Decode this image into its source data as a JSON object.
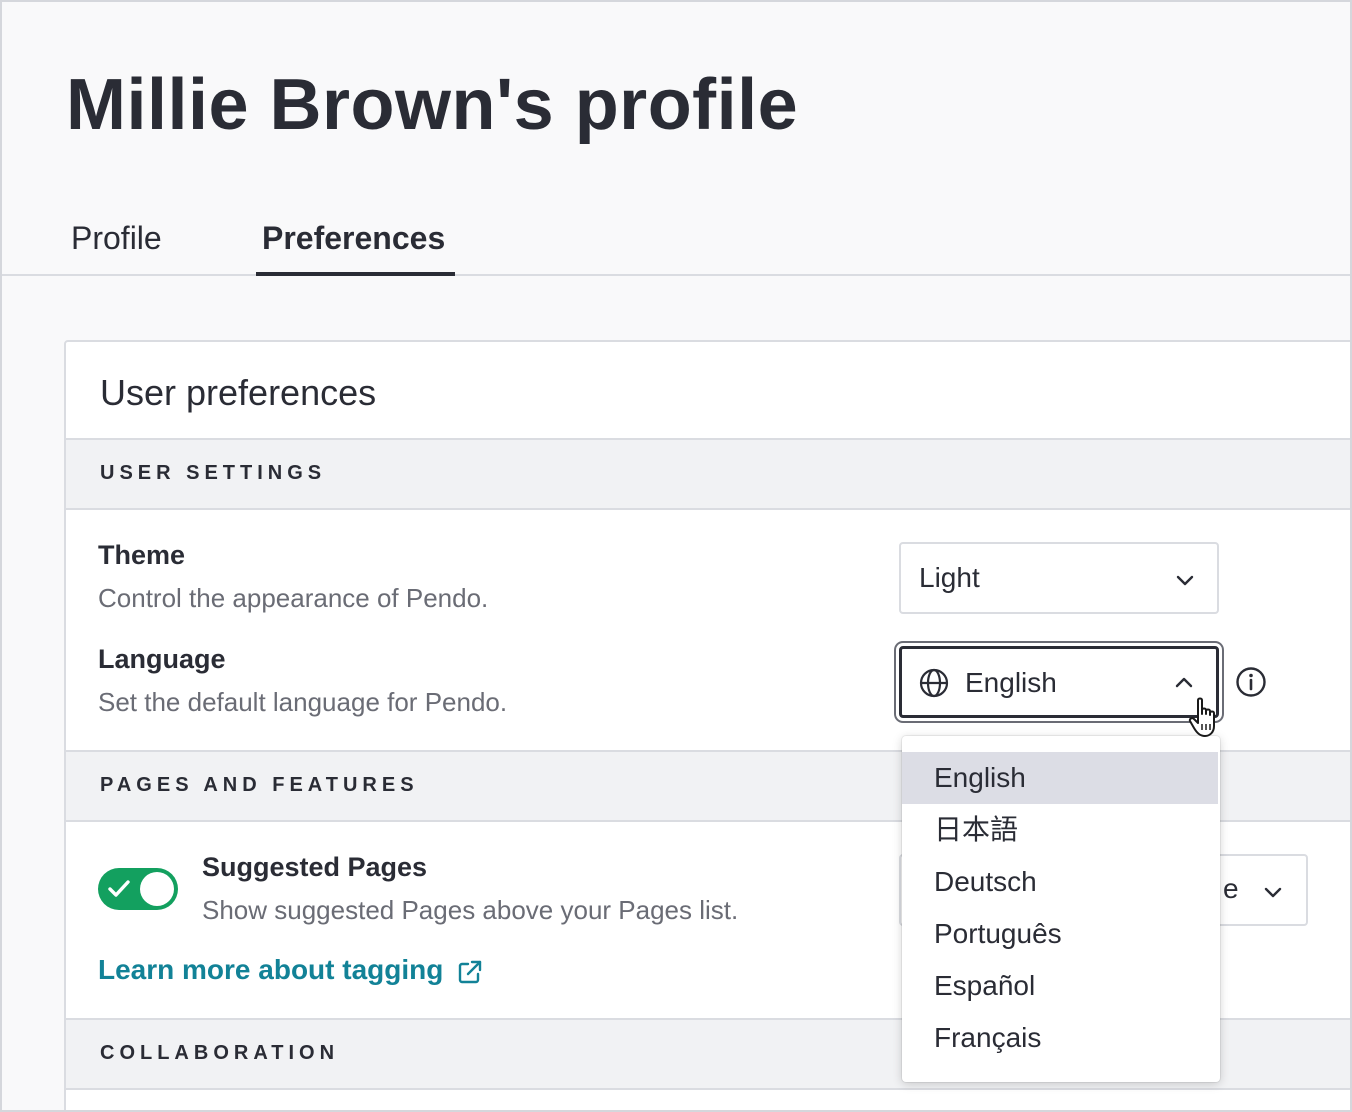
{
  "page": {
    "title": "Millie Brown's profile"
  },
  "tabs": [
    {
      "label": "Profile",
      "active": false
    },
    {
      "label": "Preferences",
      "active": true
    }
  ],
  "card": {
    "title": "User preferences"
  },
  "sections": {
    "user_settings": "USER SETTINGS",
    "pages_features": "PAGES AND FEATURES",
    "collaboration": "COLLABORATION"
  },
  "theme": {
    "title": "Theme",
    "description": "Control the appearance of Pendo.",
    "value": "Light"
  },
  "language": {
    "title": "Language",
    "description": "Set the default language for Pendo.",
    "value": "English",
    "options": [
      "English",
      "日本語",
      "Deutsch",
      "Português",
      "Español",
      "Français"
    ],
    "selected_index": 0
  },
  "suggested_pages": {
    "title": "Suggested Pages",
    "description": "Show suggested Pages above your Pages list.",
    "enabled": true,
    "select_partial_text": "e"
  },
  "learn_more": {
    "label": "Learn more about tagging"
  },
  "icons": {
    "globe": "globe-icon",
    "info": "info-icon",
    "chevron_down": "chevron-down-icon",
    "chevron_up": "chevron-up-icon",
    "external_link": "external-link-icon",
    "check": "check-icon",
    "cursor": "hand-pointer-icon"
  },
  "colors": {
    "text": "#2a2c35",
    "muted": "#6a6c75",
    "toggle_on": "#13a05f",
    "link": "#128297",
    "selected_option": "#dcdde5"
  }
}
